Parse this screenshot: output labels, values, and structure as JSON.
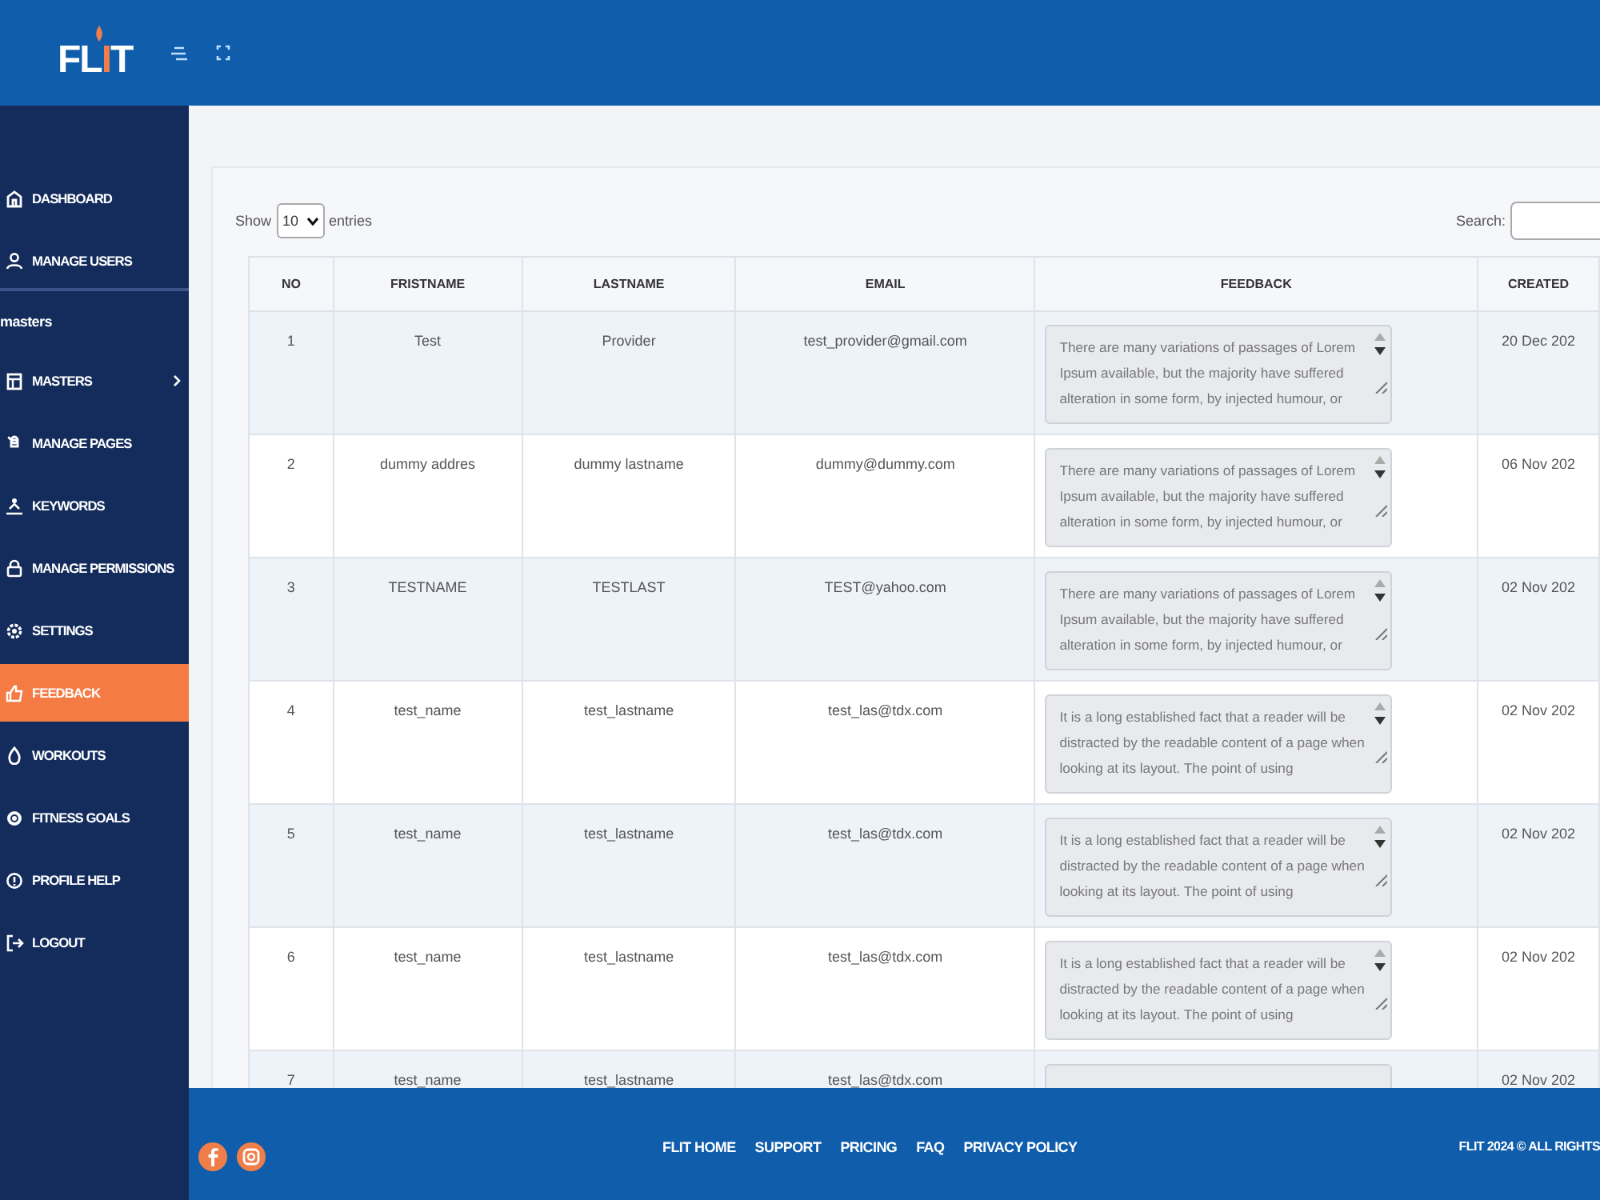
{
  "header": {
    "logo": "FLIT"
  },
  "sidebar": {
    "items": [
      {
        "label": "DASHBOARD",
        "kind": "link",
        "selected": false
      },
      {
        "label": "MANAGE USERS",
        "kind": "link",
        "selected": false
      },
      {
        "label": "masters",
        "kind": "heading"
      },
      {
        "label": "MASTERS",
        "kind": "submenu",
        "selected": false,
        "expanded": false
      },
      {
        "label": "MANAGE PAGES",
        "kind": "link",
        "selected": false
      },
      {
        "label": "KEYWORDS",
        "kind": "link",
        "selected": false
      },
      {
        "label": "MANAGE PERMISSIONS",
        "kind": "link",
        "selected": false
      },
      {
        "label": "SETTINGS",
        "kind": "link",
        "selected": false
      },
      {
        "label": "FEEDBACK",
        "kind": "link",
        "selected": true
      },
      {
        "label": "WORKOUTS",
        "kind": "link",
        "selected": false
      },
      {
        "label": "FITNESS GOALS",
        "kind": "link",
        "selected": false
      },
      {
        "label": "PROFILE HELP",
        "kind": "link",
        "selected": false
      },
      {
        "label": "LOGOUT",
        "kind": "link",
        "selected": false
      }
    ]
  },
  "controls": {
    "show_label": "Show",
    "page_size": "10",
    "entries_label": "entries",
    "search_label": "Search:"
  },
  "table": {
    "columns": [
      "NO",
      "FRISTNAME",
      "LASTNAME",
      "EMAIL",
      "FEEDBACK",
      "CREATED"
    ],
    "rows": [
      [
        "1",
        "Test",
        "Provider",
        "test_provider@gmail.com",
        "There are many variations of passages of Lorem Ipsum available, but the majority have suffered alteration in some form, by injected humour, or",
        "20 Dec 202"
      ],
      [
        "2",
        "dummy addres",
        "dummy lastname",
        "dummy@dummy.com",
        "There are many variations of passages of Lorem Ipsum available, but the majority have suffered alteration in some form, by injected humour, or",
        "06 Nov 202"
      ],
      [
        "3",
        "TESTNAME",
        "TESTLAST",
        "TEST@yahoo.com",
        "There are many variations of passages of Lorem Ipsum available, but the majority have suffered alteration in some form, by injected humour, or",
        "02 Nov 202"
      ],
      [
        "4",
        "test_name",
        "test_lastname",
        "test_las@tdx.com",
        "It is a long established fact that a reader will be distracted by the readable content of a page when looking at its layout. The point of using",
        "02 Nov 202"
      ],
      [
        "5",
        "test_name",
        "test_lastname",
        "test_las@tdx.com",
        "It is a long established fact that a reader will be distracted by the readable content of a page when looking at its layout. The point of using",
        "02 Nov 202"
      ],
      [
        "6",
        "test_name",
        "test_lastname",
        "test_las@tdx.com",
        "It is a long established fact that a reader will be distracted by the readable content of a page when looking at its layout. The point of using",
        "02 Nov 202"
      ],
      [
        "7",
        "test_name",
        "test_lastname",
        "test_las@tdx.com",
        null,
        "02 Nov 202"
      ]
    ]
  },
  "footer": {
    "links": [
      "FLIT HOME",
      "SUPPORT",
      "PRICING",
      "FAQ",
      "PRIVACY POLICY"
    ],
    "copyright": "FLIT 2024 © ALL RIGHTS"
  }
}
